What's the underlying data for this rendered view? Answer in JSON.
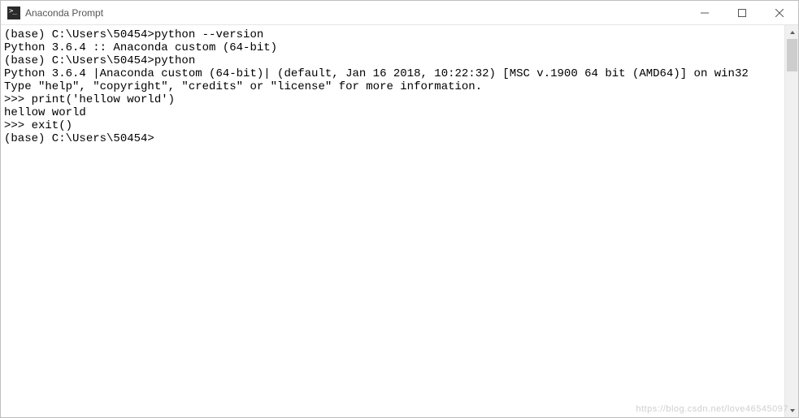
{
  "window": {
    "title": "Anaconda Prompt"
  },
  "terminal": {
    "lines": [
      "",
      "(base) C:\\Users\\50454>python --version",
      "Python 3.6.4 :: Anaconda custom (64-bit)",
      "",
      "(base) C:\\Users\\50454>python",
      "Python 3.6.4 |Anaconda custom (64-bit)| (default, Jan 16 2018, 10:22:32) [MSC v.1900 64 bit (AMD64)] on win32",
      "Type \"help\", \"copyright\", \"credits\" or \"license\" for more information.",
      ">>> print('hellow world')",
      "hellow world",
      ">>> exit()",
      "",
      "(base) C:\\Users\\50454>"
    ]
  },
  "watermark": "https://blog.csdn.net/love46545097"
}
